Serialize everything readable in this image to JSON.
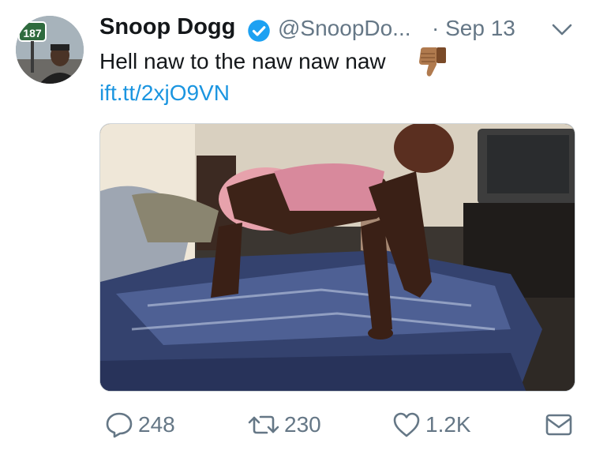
{
  "tweet": {
    "display_name": "Snoop Dogg",
    "handle": "@SnoopDo...",
    "date": "· Sep 13",
    "text": "Hell naw to the naw naw naw",
    "emoji": "thumbs-down-icon",
    "link": "ift.tt/2xjO9VN",
    "avatar_sign_text": "187"
  },
  "actions": {
    "replies": "248",
    "retweets": "230",
    "likes": "1.2K"
  },
  "colors": {
    "text": "#14171a",
    "secondary": "#657786",
    "link": "#1b95e0",
    "verified": "#1da1f2"
  }
}
